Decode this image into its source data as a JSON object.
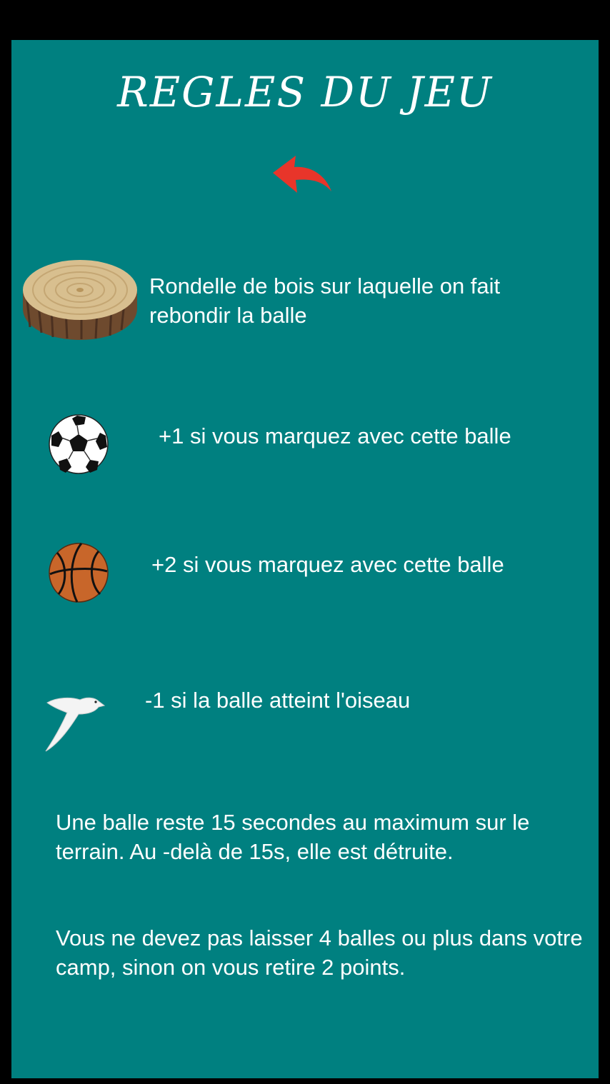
{
  "title": "REGLES DU JEU",
  "back_button": {
    "icon": "back-arrow-icon",
    "color": "#e8352a"
  },
  "rules": [
    {
      "icon": "wood-slice-icon",
      "text": "Rondelle de bois sur laquelle on fait rebondir la balle"
    },
    {
      "icon": "soccer-ball-icon",
      "text": "+1 si vous marquez avec cette balle"
    },
    {
      "icon": "basketball-icon",
      "text": "+2 si vous marquez avec cette balle"
    },
    {
      "icon": "bird-icon",
      "text": "-1 si la balle atteint l'oiseau"
    }
  ],
  "paragraphs": [
    "Une balle reste 15 secondes au maximum sur le terrain. Au -delà de 15s, elle est détruite.",
    "Vous ne devez pas laisser 4 balles ou plus dans votre camp, sinon on vous retire 2 points."
  ],
  "colors": {
    "background": "#008080",
    "frame": "#000000",
    "text": "#ffffff"
  }
}
